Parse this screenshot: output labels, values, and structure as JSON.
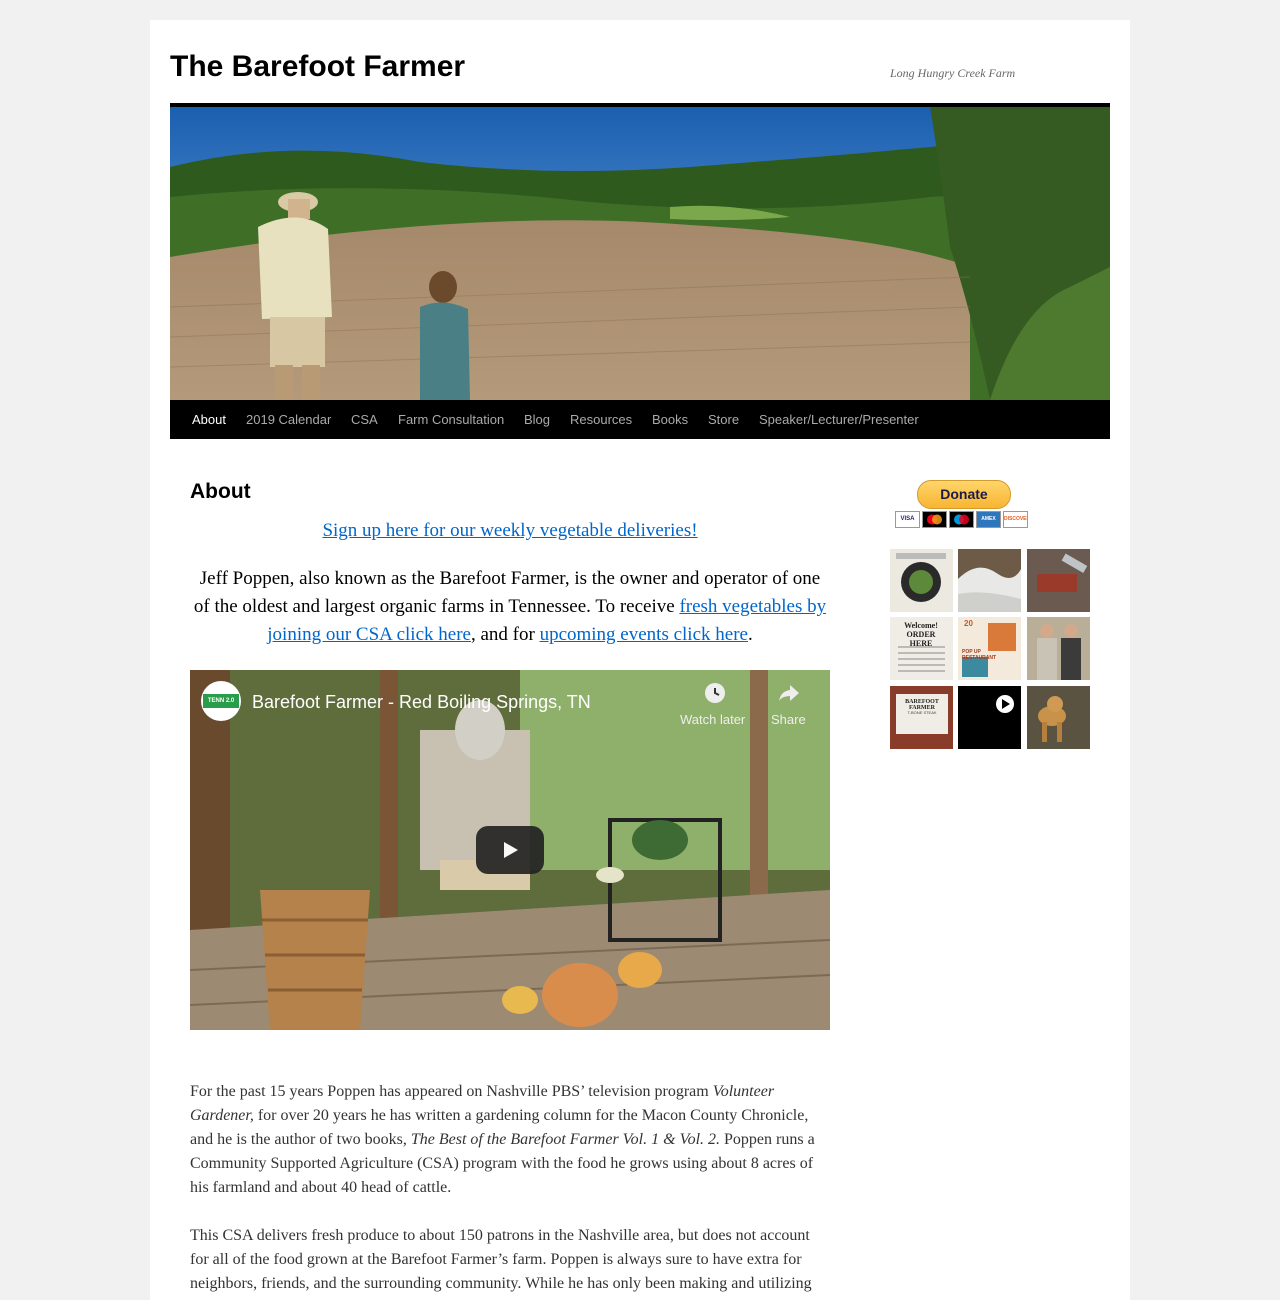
{
  "site": {
    "title": "The Barefoot Farmer",
    "description": "Long Hungry Creek Farm"
  },
  "nav": {
    "items": [
      {
        "label": "About",
        "current": true
      },
      {
        "label": "2019 Calendar"
      },
      {
        "label": "CSA"
      },
      {
        "label": "Farm Consultation"
      },
      {
        "label": "Blog"
      },
      {
        "label": "Resources"
      },
      {
        "label": "Books"
      },
      {
        "label": "Store"
      },
      {
        "label": "Speaker/Lecturer/Presenter"
      }
    ]
  },
  "page": {
    "title": "About",
    "signup_link": "Sign up here for our weekly vegetable deliveries!",
    "intro": {
      "text1": "Jeff Poppen, also known as the Barefoot Farmer, is the owner and operator of one of the oldest and largest organic farms in Tennessee. To receive ",
      "link1": "fresh vegetables by joining our CSA click here",
      "text2": ", and for ",
      "link2": "upcoming events click here",
      "text3": "."
    },
    "video": {
      "title": "Barefoot Farmer - Red Boiling Springs, TN",
      "watch_later": "Watch later",
      "share": "Share",
      "channel_badge": "TENN 2.0"
    },
    "para1": {
      "a": "For the past 15 years Poppen has appeared on Nashville PBS’ television program ",
      "b": "Volunteer Gardener,",
      "c": " for over 20 years he has written a gardening column for the Macon County Chronicle, and he is the author of two books, ",
      "d": "The Best of the Barefoot Farmer Vol. 1 & Vol. 2.",
      "e": " Poppen runs a Community Supported Agriculture (CSA) program with the food he grows using about 8 acres of his farmland and about 40 head of cattle."
    },
    "para2": "This CSA delivers fresh produce to about 150 patrons in the Nashville area, but does not account for all of the food grown at the Barefoot Farmer’s farm. Poppen is always sure to have extra for neighbors, friends, and the surrounding community. While he has only been making and utilizing"
  },
  "sidebar": {
    "donate_label": "Donate",
    "cards": [
      "VISA",
      "MC",
      "Maestro",
      "AMEX",
      "DISCOVER"
    ],
    "thumbs": {
      "t4": "Welcome! ORDER HERE",
      "t5a": "20",
      "t5b": "POP UP RESTAURANT",
      "t7": "BAREFOOT FARMER",
      "t7b": "T-BONE STEAK"
    }
  },
  "colors": {
    "link": "#0066cc",
    "nav_bg": "#000000",
    "page_bg": "#f1f1f1"
  }
}
